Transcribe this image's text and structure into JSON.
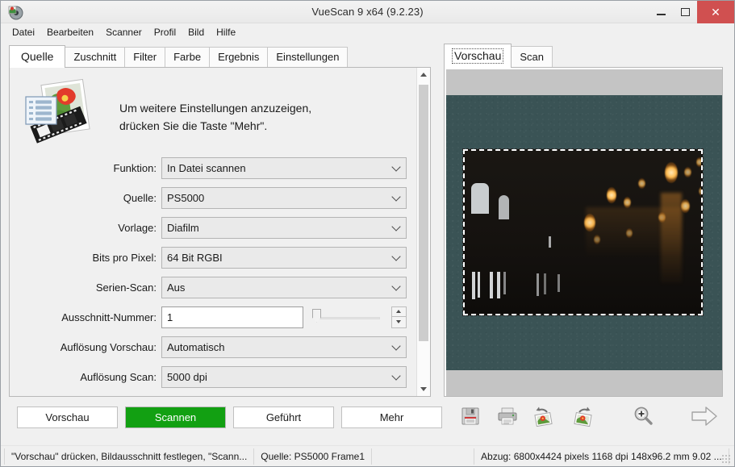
{
  "window": {
    "title": "VueScan 9 x64 (9.2.23)",
    "app_icon": "vuescan-app-icon",
    "controls": {
      "minimize": "–",
      "maximize": "□",
      "close": "✕"
    }
  },
  "menubar": {
    "items": [
      {
        "label": "Datei"
      },
      {
        "label": "Bearbeiten"
      },
      {
        "label": "Scanner"
      },
      {
        "label": "Profil"
      },
      {
        "label": "Bild"
      },
      {
        "label": "Hilfe"
      }
    ]
  },
  "left_panel": {
    "tabs": [
      {
        "label": "Quelle",
        "active": true
      },
      {
        "label": "Zuschnitt",
        "active": false
      },
      {
        "label": "Filter",
        "active": false
      },
      {
        "label": "Farbe",
        "active": false
      },
      {
        "label": "Ergebnis",
        "active": false
      },
      {
        "label": "Einstellungen",
        "active": false
      }
    ],
    "info": {
      "icon": "vuescan-film-photo-icon",
      "line1": "Um weitere Einstellungen anzuzeigen,",
      "line2": "drücken Sie die Taste \"Mehr\"."
    },
    "fields": [
      {
        "label": "Funktion:",
        "value": "In Datei scannen",
        "type": "select"
      },
      {
        "label": "Quelle:",
        "value": "PS5000",
        "type": "select"
      },
      {
        "label": "Vorlage:",
        "value": "Diafilm",
        "type": "select"
      },
      {
        "label": "Bits pro Pixel:",
        "value": "64 Bit RGBI",
        "type": "select"
      },
      {
        "label": "Serien-Scan:",
        "value": "Aus",
        "type": "select"
      },
      {
        "label": "Ausschnitt-Nummer:",
        "value": "1",
        "type": "text-slider-spinner"
      },
      {
        "label": "Auflösung Vorschau:",
        "value": "Automatisch",
        "type": "select"
      },
      {
        "label": "Auflösung Scan:",
        "value": "5000 dpi",
        "type": "select"
      }
    ],
    "buttons": [
      {
        "label": "Vorschau",
        "primary": false
      },
      {
        "label": "Scannen",
        "primary": true
      },
      {
        "label": "Geführt",
        "primary": false
      },
      {
        "label": "Mehr",
        "primary": false
      }
    ]
  },
  "right_panel": {
    "tabs": [
      {
        "label": "Vorschau",
        "active": true
      },
      {
        "label": "Scan",
        "active": false
      }
    ],
    "preview": {
      "background_color": "#3a5355",
      "frame_color": "#c4c4c4",
      "selection": "dashed-marquee"
    },
    "toolbar": [
      {
        "icon": "save-icon",
        "label": "Speichern"
      },
      {
        "icon": "print-icon",
        "label": "Drucken"
      },
      {
        "icon": "rotate-left-icon",
        "label": "Nach links drehen"
      },
      {
        "icon": "rotate-right-icon",
        "label": "Nach rechts drehen"
      },
      {
        "icon": "zoom-in-icon",
        "label": "Vergrößern"
      },
      {
        "icon": "next-arrow-icon",
        "label": "Weiter"
      }
    ]
  },
  "statusbar": {
    "hint": "\"Vorschau\" drücken, Bildausschnitt festlegen, \"Scann...",
    "source": "Quelle: PS5000 Frame1",
    "output": "Abzug: 6800x4424 pixels 1168 dpi 148x96.2 mm 9.02 ..."
  },
  "colors": {
    "accent_green": "#12a012",
    "close_red": "#d05050",
    "preview_bg": "#3a5355",
    "panel_bg": "#f0f0f0"
  }
}
